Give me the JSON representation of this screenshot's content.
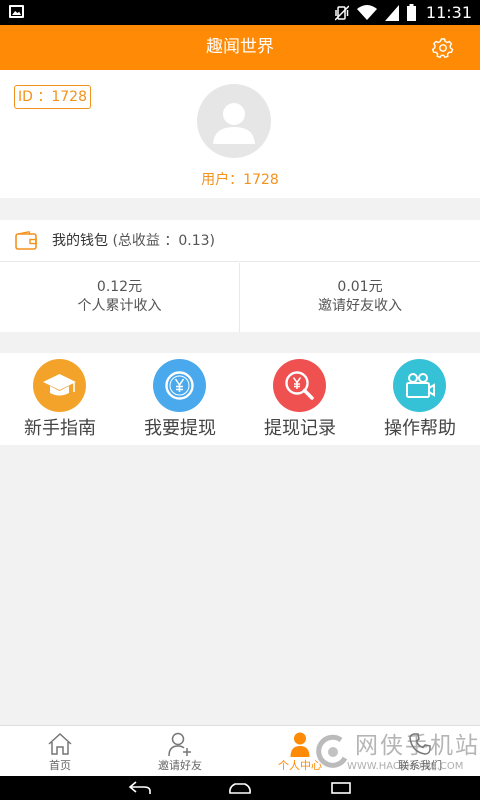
{
  "status_bar": {
    "time": "11:31",
    "icons": [
      "image-notification-icon",
      "vibrate-icon",
      "wifi-icon",
      "signal-icon",
      "battery-icon"
    ]
  },
  "header": {
    "title": "趣闻世界",
    "settings_icon": "gear-icon",
    "background_color": "#ff8a05"
  },
  "profile": {
    "id_label": "ID ：1728",
    "username": "用户：1728",
    "avatar_icon": "default-avatar-icon"
  },
  "wallet": {
    "title": "我的钱包",
    "total": "(总收益 ：0.13)",
    "personal": {
      "amount": "0.12元",
      "label": "个人累计收入"
    },
    "invite": {
      "amount": "0.01元",
      "label": "邀请好友收入"
    }
  },
  "actions": [
    {
      "label": "新手指南",
      "icon": "graduation-cap-icon",
      "color": "#f4a32a"
    },
    {
      "label": "我要提现",
      "icon": "yen-coin-icon",
      "color": "#49a9ec"
    },
    {
      "label": "提现记录",
      "icon": "yen-search-icon",
      "color": "#ef5151"
    },
    {
      "label": "操作帮助",
      "icon": "video-camera-icon",
      "color": "#35c1d6"
    }
  ],
  "tabs": [
    {
      "label": "首页",
      "icon": "home-icon",
      "active": false
    },
    {
      "label": "邀请好友",
      "icon": "add-user-icon",
      "active": false
    },
    {
      "label": "个人中心",
      "icon": "person-icon",
      "active": true
    },
    {
      "label": "联系我们",
      "icon": "phone-icon",
      "active": false
    }
  ],
  "watermark": {
    "text": "网侠手机站",
    "url": "WWW.HACKHOME.COM"
  },
  "accent_color": "#ff8a05"
}
